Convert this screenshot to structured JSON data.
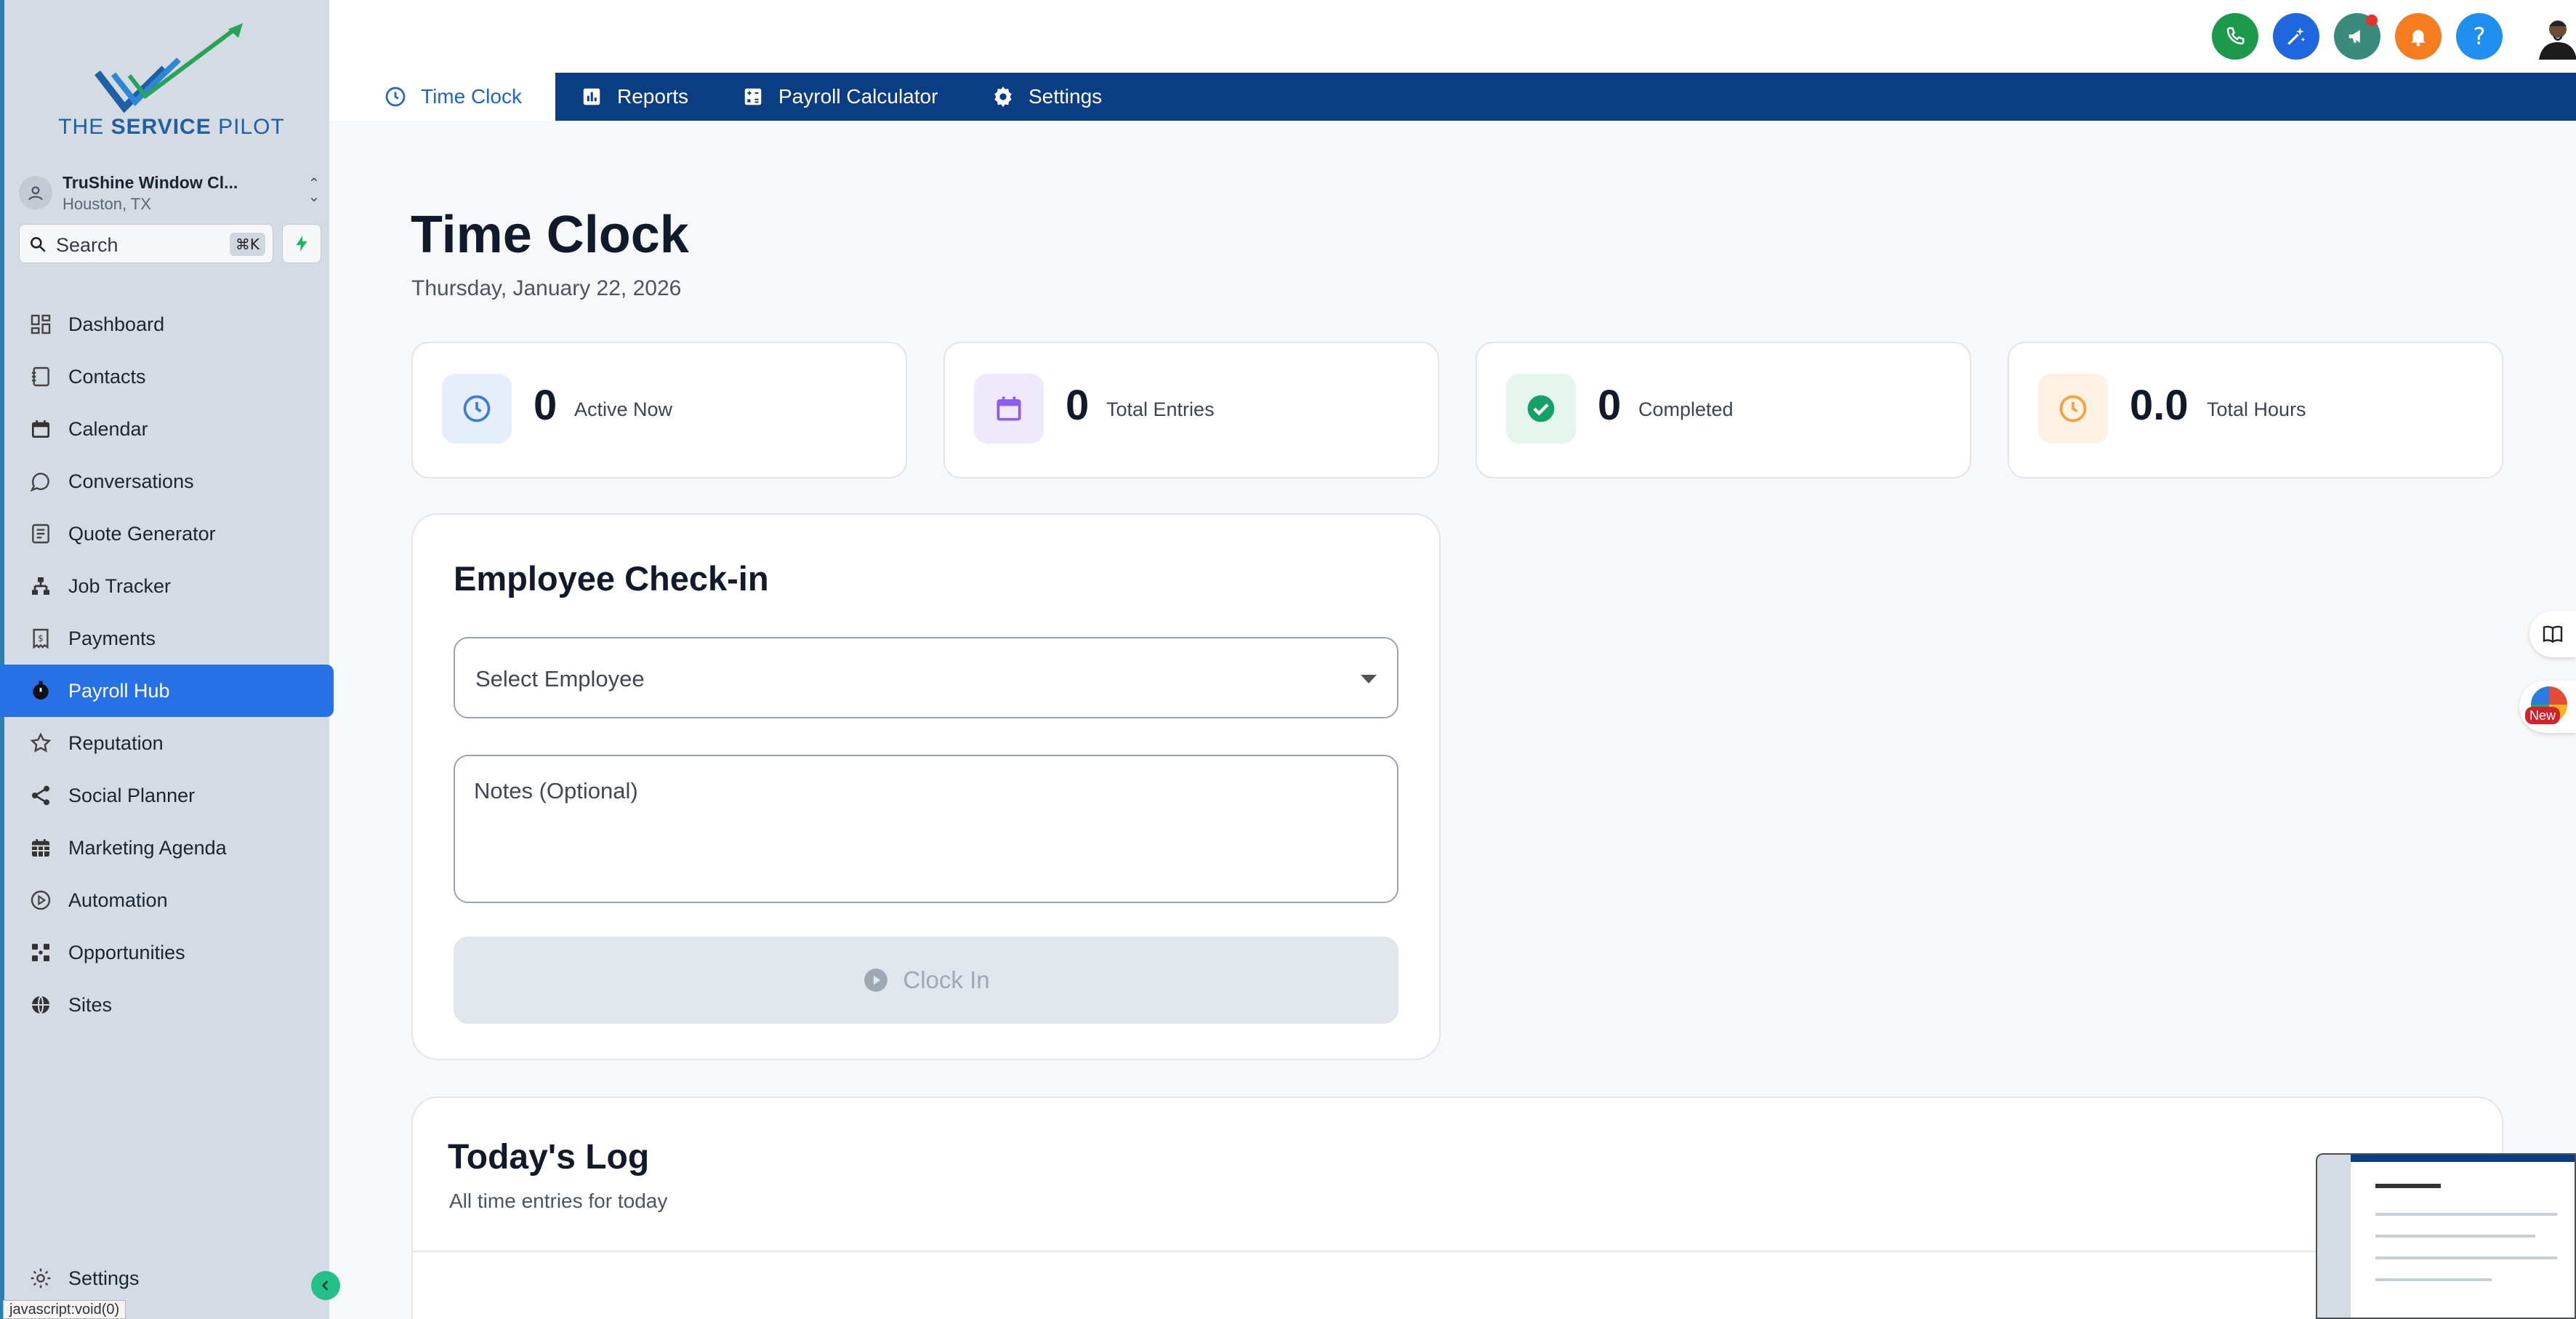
{
  "brand": {
    "name_plain": "THE",
    "name_bold": "SERVICE",
    "name_tail": "PILOT"
  },
  "account": {
    "name": "TruShine Window Cl...",
    "location": "Houston, TX"
  },
  "search": {
    "label": "Search",
    "shortcut": "⌘K"
  },
  "sidebar": {
    "items": [
      {
        "label": "Dashboard",
        "icon": "dashboard-icon"
      },
      {
        "label": "Contacts",
        "icon": "contacts-icon"
      },
      {
        "label": "Calendar",
        "icon": "calendar-icon"
      },
      {
        "label": "Conversations",
        "icon": "chat-icon"
      },
      {
        "label": "Quote Generator",
        "icon": "quote-icon"
      },
      {
        "label": "Job Tracker",
        "icon": "sitemap-icon"
      },
      {
        "label": "Payments",
        "icon": "receipt-icon"
      },
      {
        "label": "Payroll Hub",
        "icon": "stopwatch-icon",
        "active": true
      },
      {
        "label": "Reputation",
        "icon": "star-icon"
      },
      {
        "label": "Social Planner",
        "icon": "share-icon"
      },
      {
        "label": "Marketing Agenda",
        "icon": "calendar-grid-icon"
      },
      {
        "label": "Automation",
        "icon": "play-circle-icon"
      },
      {
        "label": "Opportunities",
        "icon": "funnel-icon"
      },
      {
        "label": "Sites",
        "icon": "globe-icon"
      }
    ],
    "settings_label": "Settings"
  },
  "statusbar": {
    "text": "javascript:void(0)"
  },
  "header": {
    "buttons": [
      {
        "name": "phone-icon",
        "color": "#1b9a4c"
      },
      {
        "name": "magic-icon",
        "color": "#1f66e0"
      },
      {
        "name": "megaphone-icon",
        "color": "#3a8c7a"
      },
      {
        "name": "bell-icon",
        "color": "#f57c1f"
      },
      {
        "name": "help-icon",
        "color": "#1f8ff0"
      }
    ]
  },
  "tabs": [
    {
      "label": "Time Clock",
      "icon": "clock-icon",
      "active": true
    },
    {
      "label": "Reports",
      "icon": "bar-chart-icon"
    },
    {
      "label": "Payroll Calculator",
      "icon": "calculator-icon"
    },
    {
      "label": "Settings",
      "icon": "gear-icon"
    }
  ],
  "page": {
    "title": "Time Clock",
    "date": "Thursday, January 22, 2026"
  },
  "stats": [
    {
      "value": "0",
      "label": "Active Now",
      "icon": "clock-icon",
      "accent": "#3b7be0",
      "bg": "#e7eefb"
    },
    {
      "value": "0",
      "label": "Total Entries",
      "icon": "calendar-icon",
      "accent": "#8b5cf6",
      "bg": "#efe9fc"
    },
    {
      "value": "0",
      "label": "Completed",
      "icon": "check-circle-icon",
      "accent": "#12a167",
      "bg": "#e4f5ed"
    },
    {
      "value": "0.0",
      "label": "Total Hours",
      "icon": "clock-icon",
      "accent": "#f5a23a",
      "bg": "#fdf1e4"
    }
  ],
  "checkin": {
    "title": "Employee Check-in",
    "select_label": "Select Employee",
    "notes_placeholder": "Notes (Optional)",
    "button_label": "Clock In"
  },
  "log": {
    "title": "Today's Log",
    "subtitle": "All time entries for today"
  },
  "widgets": {
    "new_label": "New"
  }
}
